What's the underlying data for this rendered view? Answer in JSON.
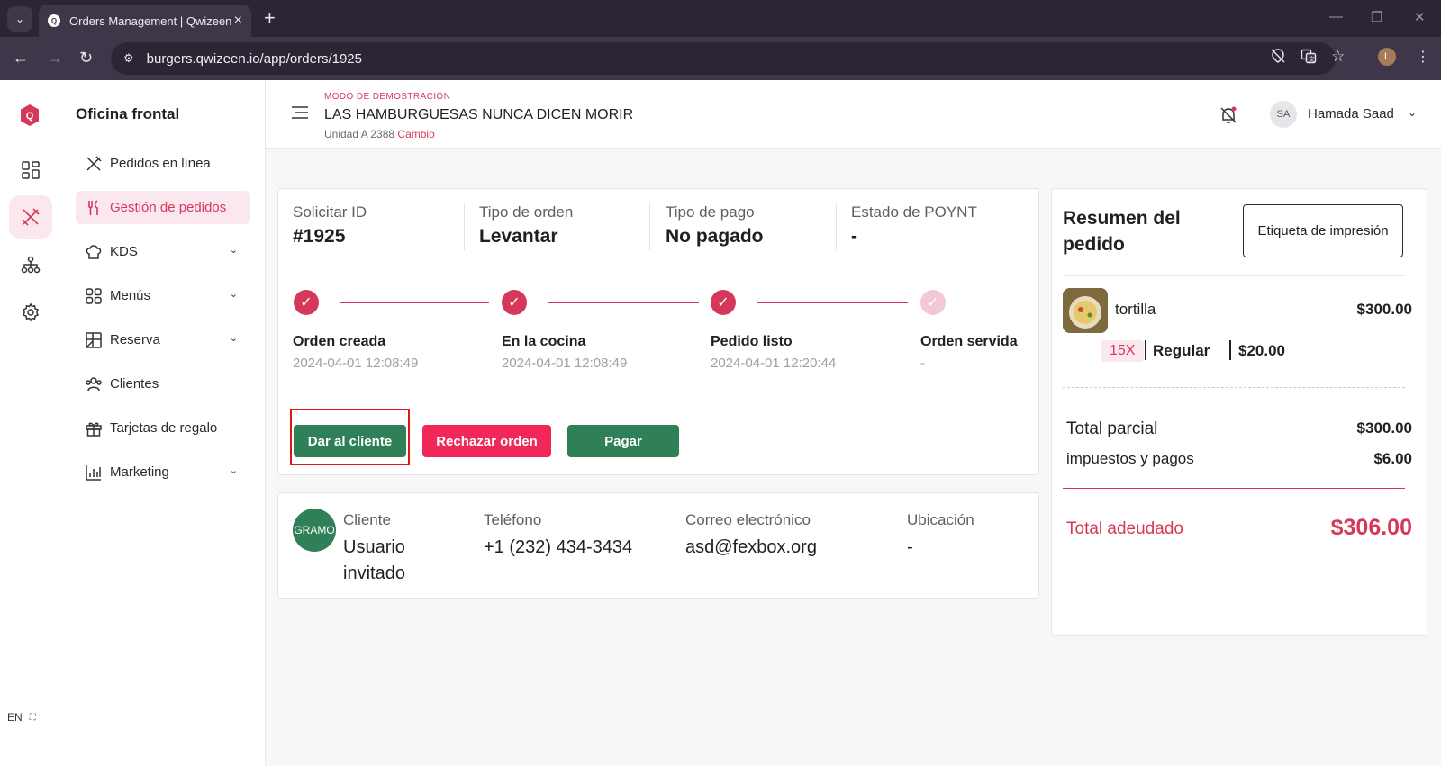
{
  "browser": {
    "tab_title": "Orders Management | Qwizeen",
    "url": "burgers.qwizeen.io/app/orders/1925",
    "profile_initial": "L"
  },
  "rail": {
    "logo_letter": "Q",
    "language": "EN"
  },
  "sidebar": {
    "brand": "Oficina frontal",
    "items": [
      {
        "label": "Pedidos en línea",
        "icon": "utensils-icon",
        "has_chevron": false
      },
      {
        "label": "Gestión de pedidos",
        "icon": "fork-knife-icon",
        "has_chevron": false,
        "active": true
      },
      {
        "label": "KDS",
        "icon": "chef-hat-icon",
        "has_chevron": true
      },
      {
        "label": "Menús",
        "icon": "grid-icon",
        "has_chevron": true
      },
      {
        "label": "Reserva",
        "icon": "table-icon",
        "has_chevron": true
      },
      {
        "label": "Clientes",
        "icon": "users-icon",
        "has_chevron": false
      },
      {
        "label": "Tarjetas de regalo",
        "icon": "gift-icon",
        "has_chevron": false
      },
      {
        "label": "Marketing",
        "icon": "bar-chart-icon",
        "has_chevron": true
      }
    ]
  },
  "header": {
    "demo_mode": "MODO DE DEMOSTRACIÓN",
    "store_name": "LAS HAMBURGUESAS NUNCA DICEN MORIR",
    "unit": "Unidad A 2388",
    "change": "Cambio",
    "user_initials": "SA",
    "user_name": "Hamada Saad"
  },
  "order": {
    "meta": [
      {
        "label": "Solicitar ID",
        "value": "#1925"
      },
      {
        "label": "Tipo de orden",
        "value": "Levantar"
      },
      {
        "label": "Tipo de pago",
        "value": "No pagado"
      },
      {
        "label": "Estado de POYNT",
        "value": "-"
      }
    ],
    "steps": [
      {
        "name": "Orden creada",
        "time": "2024-04-01 12:08:49",
        "done": true
      },
      {
        "name": "En la cocina",
        "time": "2024-04-01 12:08:49",
        "done": true
      },
      {
        "name": "Pedido listo",
        "time": "2024-04-01 12:20:44",
        "done": true
      },
      {
        "name": "Orden servida",
        "time": "-",
        "done": false
      }
    ],
    "buttons": {
      "give": "Dar al cliente",
      "reject": "Rechazar orden",
      "pay": "Pagar"
    }
  },
  "customer": {
    "avatar": "GRAMO",
    "client_label": "Cliente",
    "client_value": "Usuario invitado",
    "phone_label": "Teléfono",
    "phone_value": "+1 (232) 434-3434",
    "email_label": "Correo electrónico",
    "email_value": "asd@fexbox.org",
    "location_label": "Ubicación",
    "location_value": "-"
  },
  "summary": {
    "title": "Resumen del pedido",
    "print_label": "Etiqueta de impresión",
    "item": {
      "name": "tortilla",
      "price": "$300.00",
      "qty": "15X",
      "variant": "Regular",
      "modifier_price": "$20.00"
    },
    "subtotal_label": "Total parcial",
    "subtotal_value": "$300.00",
    "taxes_label": "impuestos y pagos",
    "taxes_value": "$6.00",
    "due_label": "Total adeudado",
    "due_value": "$306.00"
  },
  "colors": {
    "brand_red": "#d6385b",
    "green": "#2f7f57",
    "reject_red": "#f0285a"
  }
}
